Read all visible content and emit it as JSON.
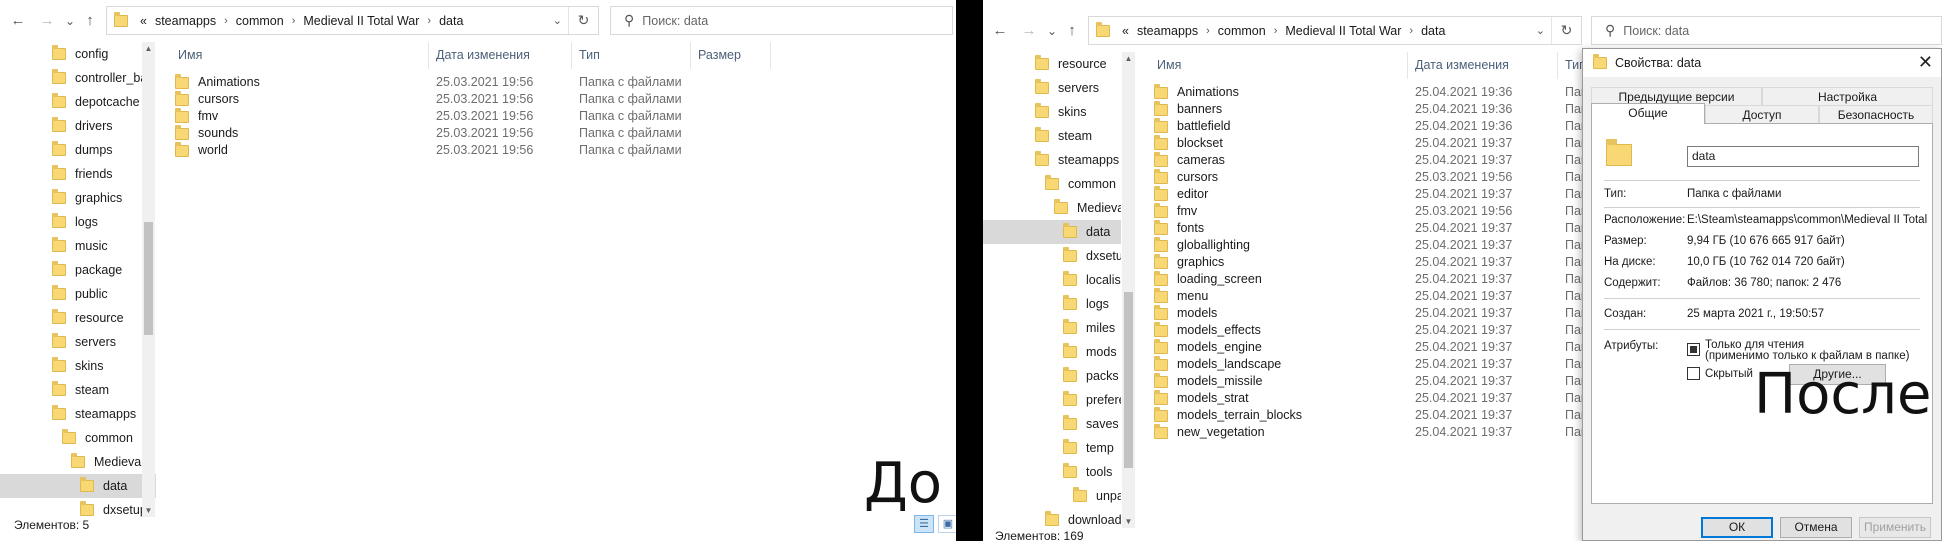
{
  "left": {
    "nav": {
      "back": "←",
      "forward": "→",
      "recent": "⌄",
      "up": "↑"
    },
    "address": {
      "overflow": "«",
      "crumbs": [
        "steamapps",
        "common",
        "Medieval II Total War",
        "data"
      ]
    },
    "search_placeholder": "Поиск: data",
    "tree": [
      "config",
      "controller_ba",
      "depotcache",
      "drivers",
      "dumps",
      "friends",
      "graphics",
      "logs",
      "music",
      "package",
      "public",
      "resource",
      "servers",
      "skins",
      "steam",
      "steamapps",
      "common",
      "Medieval I",
      "data",
      "dxsetup"
    ],
    "columns": {
      "name": "Имя",
      "date": "Дата изменения",
      "type": "Тип",
      "size": "Размер"
    },
    "files": [
      {
        "name": "Animations",
        "date": "25.03.2021 19:56",
        "type": "Папка с файлами"
      },
      {
        "name": "cursors",
        "date": "25.03.2021 19:56",
        "type": "Папка с файлами"
      },
      {
        "name": "fmv",
        "date": "25.03.2021 19:56",
        "type": "Папка с файлами"
      },
      {
        "name": "sounds",
        "date": "25.03.2021 19:56",
        "type": "Папка с файлами"
      },
      {
        "name": "world",
        "date": "25.03.2021 19:56",
        "type": "Папка с файлами"
      }
    ],
    "status": "Элементов: 5",
    "caption": "До"
  },
  "right": {
    "address": {
      "overflow": "«",
      "crumbs": [
        "steamapps",
        "common",
        "Medieval II Total War",
        "data"
      ]
    },
    "search_placeholder": "Поиск: data",
    "tree": [
      "resource",
      "servers",
      "skins",
      "steam",
      "steamapps",
      "common",
      "Medieval I",
      "data",
      "dxsetup",
      "localised",
      "logs",
      "miles",
      "mods",
      "packs",
      "preferen",
      "saves",
      "temp",
      "tools",
      "unpack",
      "downloadin"
    ],
    "columns": {
      "name": "Имя",
      "date": "Дата изменения",
      "type": "Тип"
    },
    "files": [
      {
        "name": "Animations",
        "date": "25.04.2021 19:36",
        "type": "Пап"
      },
      {
        "name": "banners",
        "date": "25.04.2021 19:36",
        "type": "Пап"
      },
      {
        "name": "battlefield",
        "date": "25.04.2021 19:36",
        "type": "Пап"
      },
      {
        "name": "blockset",
        "date": "25.04.2021 19:37",
        "type": "Пап"
      },
      {
        "name": "cameras",
        "date": "25.04.2021 19:37",
        "type": "Пап"
      },
      {
        "name": "cursors",
        "date": "25.03.2021 19:56",
        "type": "Пап"
      },
      {
        "name": "editor",
        "date": "25.04.2021 19:37",
        "type": "Пап"
      },
      {
        "name": "fmv",
        "date": "25.03.2021 19:56",
        "type": "Пап"
      },
      {
        "name": "fonts",
        "date": "25.04.2021 19:37",
        "type": "Пап"
      },
      {
        "name": "globallighting",
        "date": "25.04.2021 19:37",
        "type": "Пап"
      },
      {
        "name": "graphics",
        "date": "25.04.2021 19:37",
        "type": "Пап"
      },
      {
        "name": "loading_screen",
        "date": "25.04.2021 19:37",
        "type": "Пап"
      },
      {
        "name": "menu",
        "date": "25.04.2021 19:37",
        "type": "Пап"
      },
      {
        "name": "models",
        "date": "25.04.2021 19:37",
        "type": "Пап"
      },
      {
        "name": "models_effects",
        "date": "25.04.2021 19:37",
        "type": "Пап"
      },
      {
        "name": "models_engine",
        "date": "25.04.2021 19:37",
        "type": "Пап"
      },
      {
        "name": "models_landscape",
        "date": "25.04.2021 19:37",
        "type": "Пап"
      },
      {
        "name": "models_missile",
        "date": "25.04.2021 19:37",
        "type": "Пап"
      },
      {
        "name": "models_strat",
        "date": "25.04.2021 19:37",
        "type": "Пап"
      },
      {
        "name": "models_terrain_blocks",
        "date": "25.04.2021 19:37",
        "type": "Пап"
      },
      {
        "name": "new_vegetation",
        "date": "25.04.2021 19:37",
        "type": "Пап"
      }
    ],
    "status": "Элементов: 169",
    "caption": "После"
  },
  "dialog": {
    "title": "Свойства: data",
    "tabs_top": [
      "Предыдущие версии",
      "Настройка"
    ],
    "tabs_bottom": [
      "Общие",
      "Доступ",
      "Безопасность"
    ],
    "name_value": "data",
    "props": [
      {
        "label": "Тип:",
        "value": "Папка с файлами"
      },
      {
        "label": "Расположение:",
        "value": "E:\\Steam\\steamapps\\common\\Medieval II Total"
      },
      {
        "label": "Размер:",
        "value": "9,94 ГБ (10 676 665 917 байт)"
      },
      {
        "label": "На диске:",
        "value": "10,0 ГБ (10 762 014 720 байт)"
      },
      {
        "label": "Содержит:",
        "value": "Файлов: 36 780; папок: 2 476"
      }
    ],
    "created_label": "Создан:",
    "created_value": "25 марта 2021 г., 19:50:57",
    "attributes_label": "Атрибуты:",
    "readonly_label": "Только для чтения",
    "readonly_note": "(применимо только к файлам в папке)",
    "hidden_label": "Скрытый",
    "other_button": "Другие...",
    "ok": "ОК",
    "cancel": "Отмена",
    "apply": "Применить"
  }
}
